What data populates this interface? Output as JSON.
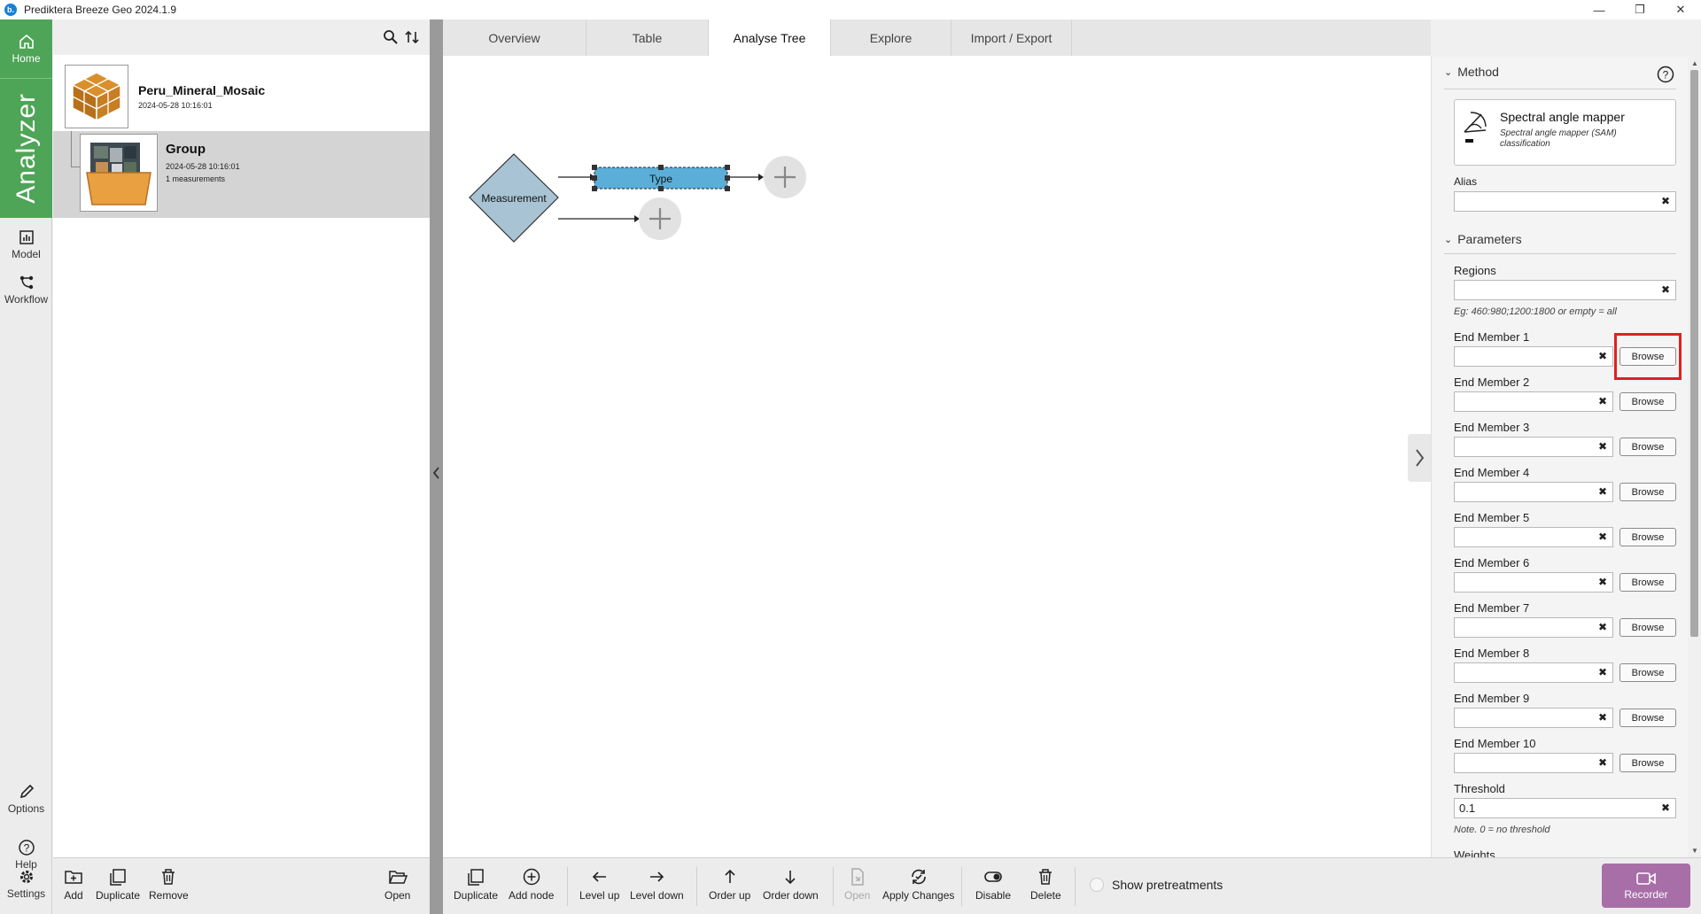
{
  "window": {
    "title": "Prediktera Breeze Geo 2024.1.9",
    "app_icon": "b."
  },
  "nav": {
    "home": "Home",
    "analyzer": "Analyzer",
    "model": "Model",
    "workflow": "Workflow",
    "options": "Options",
    "help": "Help",
    "settings": "Settings",
    "accent": "#4ea557"
  },
  "tree": {
    "project": {
      "title": "Peru_Mineral_Mosaic",
      "date": "2024-05-28 10:16:01"
    },
    "group": {
      "title": "Group",
      "date": "2024-05-28 10:16:01",
      "count": "1 measurements"
    }
  },
  "tabs": [
    "Overview",
    "Table",
    "Analyse Tree",
    "Explore",
    "Import / Export"
  ],
  "active_tab": "Analyse Tree",
  "analyse_tree": {
    "root": "Measurement",
    "child": "Type",
    "node_color": "#5aaed8",
    "root_color": "#a8c4d4"
  },
  "method": {
    "header": "Method",
    "name": "Spectral angle mapper",
    "desc_line1": "Spectral angle mapper (SAM)",
    "desc_line2": "classification",
    "alias_label": "Alias",
    "alias_value": ""
  },
  "parameters": {
    "header": "Parameters",
    "regions_label": "Regions",
    "regions_value": "",
    "regions_hint": "Eg: 460:980;1200:1800 or empty = all",
    "browse_label": "Browse",
    "end_members": [
      "End Member 1",
      "End Member 2",
      "End Member 3",
      "End Member 4",
      "End Member 5",
      "End Member 6",
      "End Member 7",
      "End Member 8",
      "End Member 9",
      "End Member 10"
    ],
    "threshold_label": "Threshold",
    "threshold_value": "0.1",
    "threshold_hint": "Note. 0 = no threshold",
    "weights_label": "Weights"
  },
  "bottom_left": {
    "add": "Add",
    "duplicate": "Duplicate",
    "remove": "Remove",
    "open": "Open"
  },
  "bottom_center": {
    "duplicate": "Duplicate",
    "add_node": "Add node",
    "level_up": "Level up",
    "level_down": "Level down",
    "order_up": "Order up",
    "order_down": "Order down",
    "open": "Open",
    "apply_changes": "Apply Changes",
    "disable": "Disable",
    "delete": "Delete",
    "show_pretreatments": "Show pretreatments",
    "recorder": "Recorder",
    "recorder_color": "#a86ea8"
  },
  "highlight_color": "#e02020"
}
